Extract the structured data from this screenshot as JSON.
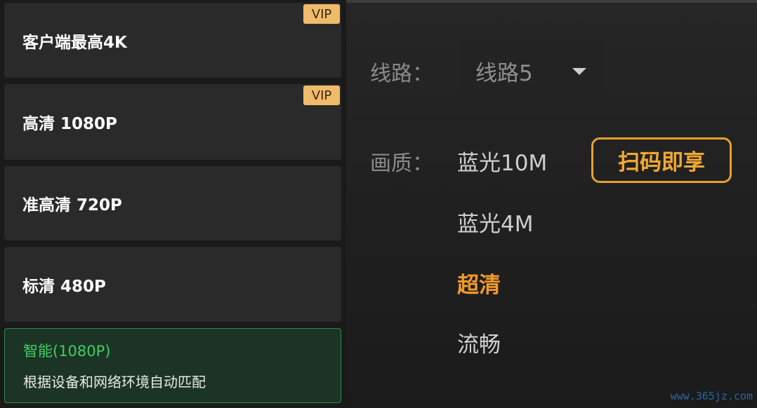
{
  "quality_list": [
    {
      "label": "客户端最高4K",
      "badge": "VIP"
    },
    {
      "label": "高清 1080P",
      "badge": "VIP"
    },
    {
      "label": "准高清 720P"
    },
    {
      "label": "标清 480P"
    }
  ],
  "smart": {
    "title": "智能(1080P)",
    "subtitle": "根据设备和网络环境自动匹配"
  },
  "settings": {
    "route_label": "线路：",
    "route_value": "线路5",
    "quality_label": "画质：",
    "options": [
      "蓝光10M",
      "蓝光4M",
      "超清",
      "流畅"
    ],
    "active_option": "超清",
    "scan_button": "扫码即享"
  },
  "watermark": "www.365jz.com",
  "colors": {
    "vip_badge": "#f0bb6a",
    "smart_green": "#3ecf63",
    "active_orange": "#f19a2c"
  }
}
